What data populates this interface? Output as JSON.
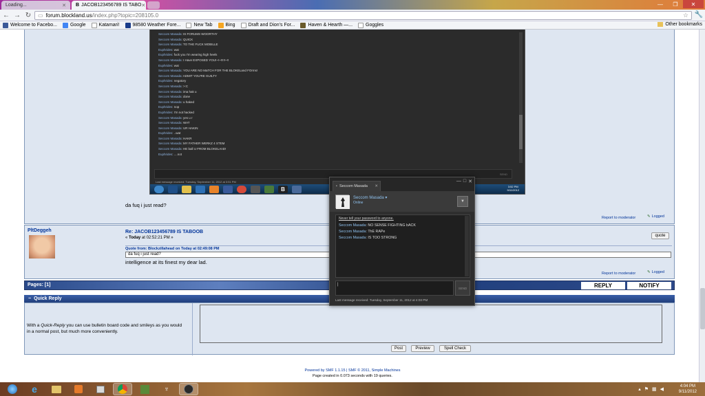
{
  "browser": {
    "tabs": [
      {
        "title": "Loading..."
      },
      {
        "title": "JACOB123456789 IS TABO"
      }
    ],
    "url_host": "forum.blockland.us",
    "url_path": "/index.php?topic=208105.0",
    "bookmarks": [
      "Welcome to Facebo...",
      "Google",
      "Katamari!",
      "98580 Weather Fore...",
      "New Tab",
      "Bing",
      "Draft and Dion's For...",
      "Haven & Hearth —...",
      "Goggles"
    ],
    "other_bookmarks": "Other bookmarks"
  },
  "screenshot_chat": [
    {
      "who": "Seccom Masada",
      "text": "IS FORUMS WOORTHY"
    },
    {
      "who": "Seccom Masada",
      "text": "QUICK"
    },
    {
      "who": "Seccom Masada",
      "text": "TO THE FUCK MOBILLE"
    },
    {
      "who": "Euphrides",
      "text": "wat"
    },
    {
      "who": "Euphrides",
      "text": "fuck you I'm wearing high heels"
    },
    {
      "who": "Seccom Masada",
      "text": "I Have EXPOSED YOU!~!~!!!!!~!!"
    },
    {
      "who": "Euphrides",
      "text": "wat"
    },
    {
      "who": "Seccom Masada",
      "text": "YOU ARE NO MaTCH FOR THE BLOKELand FOrms!"
    },
    {
      "who": "Seccom Masada",
      "text": "ADMIT YOU'RE GUILTY"
    },
    {
      "who": "Euphrides",
      "text": "negatory"
    },
    {
      "who": "Seccom Masada",
      "text": ">:C"
    },
    {
      "who": "Seccom Masada",
      "text": "ima hak u"
    },
    {
      "who": "Seccom Masada",
      "text": "done"
    },
    {
      "who": "Seccom Masada",
      "text": "u haked"
    },
    {
      "who": "Euphrides",
      "text": "nop"
    },
    {
      "who": "Euphrides",
      "text": "I'm not hacked"
    },
    {
      "who": "Seccom Masada",
      "text": "yes u r"
    },
    {
      "who": "Seccom Masada",
      "text": "WAT"
    },
    {
      "who": "Seccom Masada",
      "text": "UR HAKIN"
    },
    {
      "who": "Euphrides",
      "text": "..wat"
    },
    {
      "who": "Seccom Masada",
      "text": "HAKR"
    },
    {
      "who": "Seccom Masada",
      "text": "MY FATHER WERKZ 4 STEM"
    },
    {
      "who": "Seccom Masada",
      "text": "HE ball U FROM BLOKELAnD!"
    },
    {
      "who": "Euphrides",
      "text": "....not"
    }
  ],
  "screenshot_footer": "Last message received: Tuesday, September 11, 2012 at 3:51 PM",
  "screenshot_send": "SEND",
  "screenshot_clock": {
    "time": "3:52 PM",
    "date": "9/11/2012"
  },
  "post1": {
    "body": "da fuq i just read?",
    "report": "Report to moderator",
    "logged": "Logged"
  },
  "post2": {
    "author": "PltDeggeh",
    "title": "Re: JACOB123456789 IS TABOOB",
    "date_prefix": "« ",
    "date_bold": "Today",
    "date_rest": " at 02:52:21 PM »",
    "quote_header": "Quote from: Blockzillahead on Today at 02:49:08 PM",
    "quote_text": "da fuq i just read?",
    "body": "intelligence at its finest my dear lad.",
    "quote_btn": "quote",
    "report": "Report to moderator",
    "logged": "Logged"
  },
  "pages": {
    "label": "Pages:",
    "value": "[1]",
    "reply": "REPLY",
    "notify": "NOTIFY"
  },
  "quick_reply": {
    "title": "Quick Reply",
    "desc_pre": "With a ",
    "desc_em": "Quick-Reply",
    "desc_post": " you can use bulletin board code and smileys as you would in a normal post, but much more conveniently.",
    "post_btn": "Post",
    "preview_btn": "Preview",
    "spell_btn": "Spell Check"
  },
  "footer": {
    "line1": "Powered by SMF 1.1.15 | SMF © 2011, Simple Machines",
    "line2": "Page created in 0.073 seconds with 19 queries."
  },
  "steam": {
    "tab": "Seccom Masada",
    "name": "Seccom Masada",
    "status": "Online",
    "warning": "Never tell your password to anyone.",
    "messages": [
      {
        "who": "Seccom Masada",
        "text": "NO SENSE FIGHTING bACK"
      },
      {
        "who": "Seccom Masada",
        "text": "ThE RAPe"
      },
      {
        "who": "Seccom Masada",
        "text": "IS TOO STRONG"
      }
    ],
    "send": "SEND",
    "footer": "Last message received: Tuesday, September 11, 2012 at 4:03 PM"
  },
  "system_clock": {
    "time": "4:04 PM",
    "date": "9/11/2012"
  }
}
